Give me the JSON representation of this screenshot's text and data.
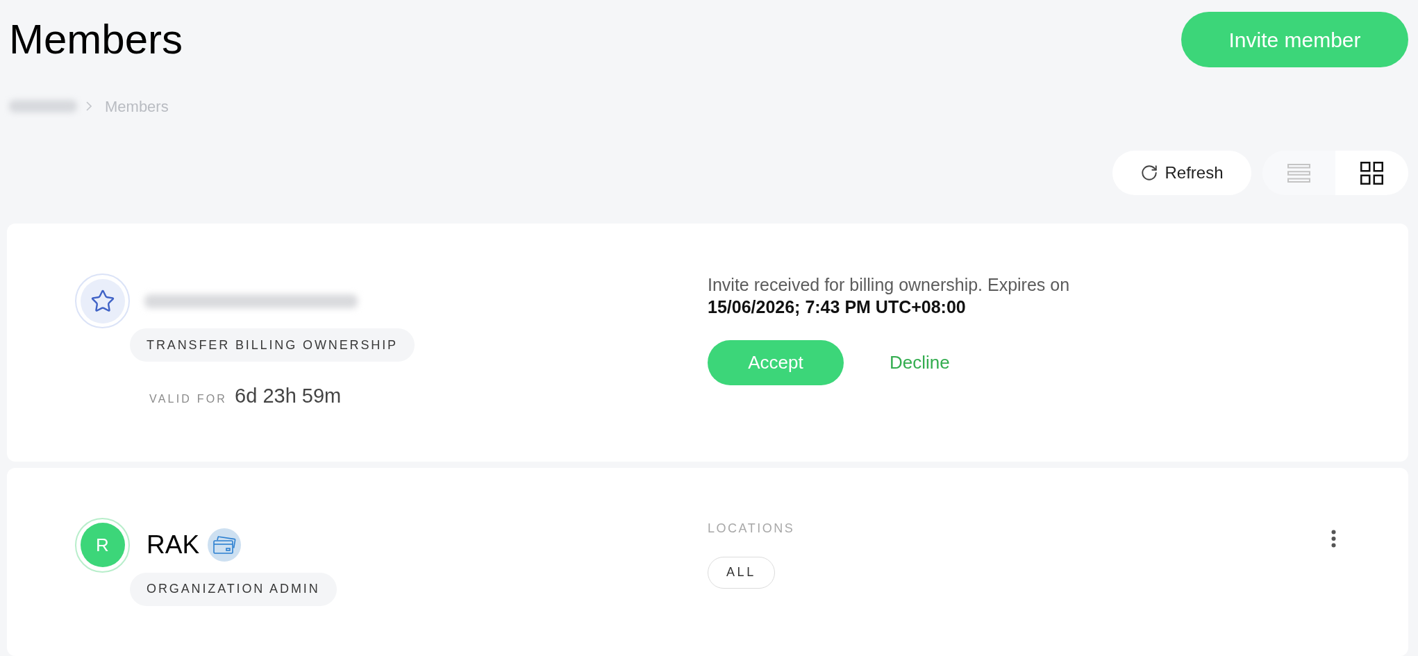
{
  "page": {
    "title": "Members",
    "primary_action": "Invite member"
  },
  "breadcrumbs": [
    {
      "redacted": true
    },
    {
      "label": "Members"
    }
  ],
  "toolbar": {
    "refresh": "Refresh",
    "view_options": [
      {
        "kind": "list",
        "selected": false
      },
      {
        "kind": "grid",
        "selected": true
      }
    ]
  },
  "members": [
    {
      "kind": "invite",
      "email_redacted": true,
      "role": "TRANSFER BILLING OWNERSHIP",
      "validity_label": "VALID FOR",
      "validity": "6d 23h 59m",
      "message": "Invite received for billing ownership. Expires on **15/06/2026; 7:43 PM UTC+08:00**",
      "actions": [
        {
          "kind": "primary",
          "label": "Accept"
        },
        {
          "kind": "link",
          "label": "Decline"
        }
      ]
    },
    {
      "kind": "member",
      "initial": "R",
      "name": "RAK",
      "billing_badge": true,
      "role": "ORGANIZATION ADMIN",
      "locations_label": "LOCATIONS",
      "locations": [
        "ALL"
      ],
      "menu": true
    }
  ]
}
